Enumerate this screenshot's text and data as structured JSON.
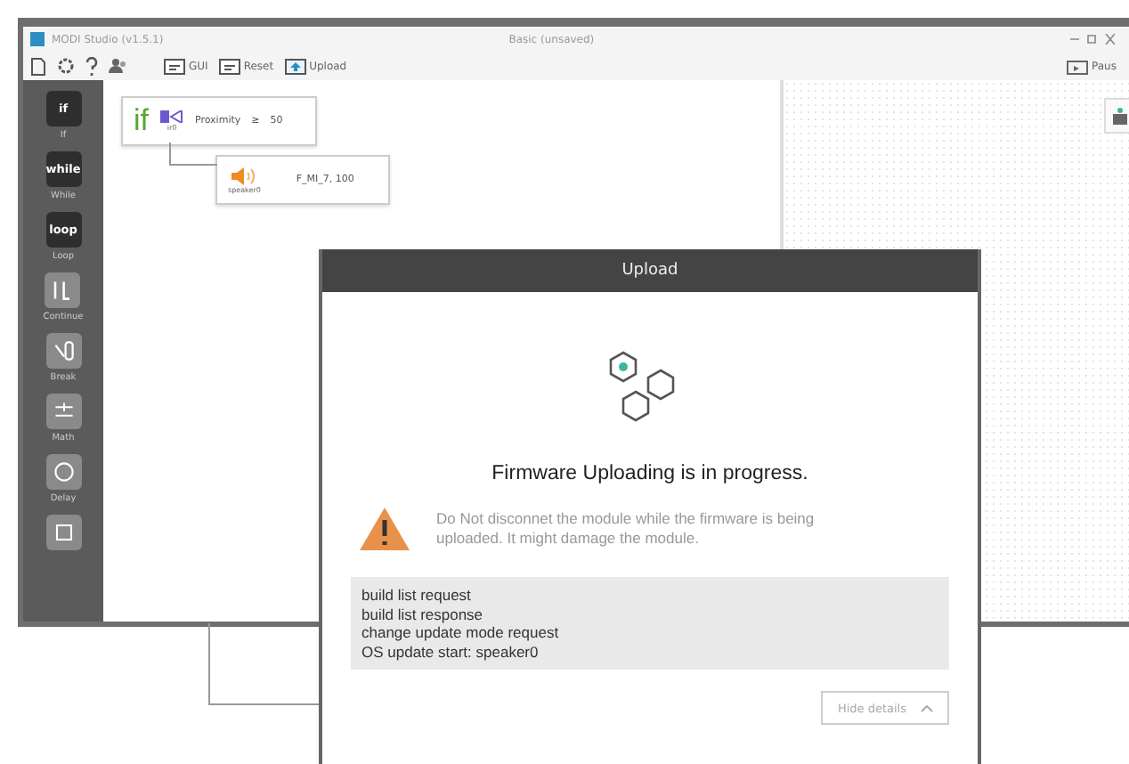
{
  "window": {
    "title": "MODI Studio (v1.5.1)",
    "document": "Basic (unsaved)"
  },
  "toolbar": {
    "buttons": [
      {
        "kind": "gui",
        "label": "GUI"
      },
      {
        "kind": "reset",
        "label": "Reset"
      },
      {
        "kind": "upload",
        "label": "Upload"
      }
    ],
    "pause_label": "Paus"
  },
  "sidebar": {
    "items": [
      {
        "kind": "word",
        "glyph": "if",
        "label": "If"
      },
      {
        "kind": "word",
        "glyph": "while",
        "label": "While"
      },
      {
        "kind": "word",
        "glyph": "loop",
        "label": "Loop"
      },
      {
        "kind": "continue",
        "label": "Continue"
      },
      {
        "kind": "break",
        "label": "Break"
      },
      {
        "kind": "math",
        "label": "Math"
      },
      {
        "kind": "delay",
        "label": "Delay"
      },
      {
        "kind": "more"
      }
    ]
  },
  "blocks": [
    {
      "kind": "if",
      "keyword": "if",
      "module": "ir0",
      "condition": "Proximity",
      "operator": "≥",
      "value": "50"
    },
    {
      "kind": "speaker",
      "module": "speaker0",
      "value": "F_MI_7, 100"
    }
  ],
  "dialog": {
    "title": "Upload",
    "heading": "Firmware Uploading is in progress.",
    "warning": "Do Not disconnet the module while the firmware is being uploaded. It might damage the module.",
    "log": [
      "build list request",
      "build list response",
      "change update mode request",
      "OS update start: speaker0"
    ],
    "details_button": "Hide details"
  }
}
